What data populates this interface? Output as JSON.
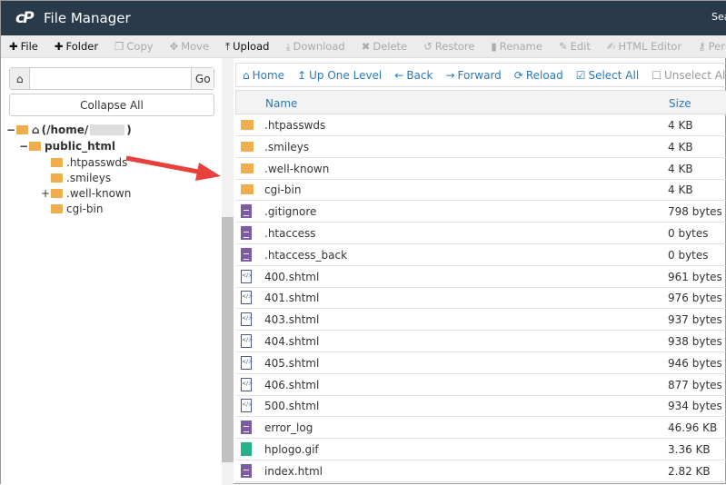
{
  "app": {
    "logo": "cP",
    "title": "File Manager",
    "search_label": "Sea"
  },
  "toolbar": [
    {
      "label": "File",
      "icon": "plus-icon",
      "on": true
    },
    {
      "label": "Folder",
      "icon": "plus-icon",
      "on": true
    },
    {
      "label": "Copy",
      "icon": "copy-icon",
      "on": false
    },
    {
      "label": "Move",
      "icon": "move-icon",
      "on": false
    },
    {
      "label": "Upload",
      "icon": "upload-icon",
      "on": true
    },
    {
      "label": "Download",
      "icon": "download-icon",
      "on": false
    },
    {
      "label": "Delete",
      "icon": "x-icon",
      "on": false
    },
    {
      "label": "Restore",
      "icon": "undo-icon",
      "on": false
    },
    {
      "label": "Rename",
      "icon": "file-icon",
      "on": false
    },
    {
      "label": "Edit",
      "icon": "pencil-icon",
      "on": false
    },
    {
      "label": "HTML Editor",
      "icon": "edit-icon",
      "on": false
    },
    {
      "label": "Perm",
      "icon": "key-icon",
      "on": false
    }
  ],
  "left": {
    "path_value": "",
    "go_label": "Go",
    "collapse_label": "Collapse All",
    "tree": [
      {
        "label": "(/home/",
        "suffix": ")",
        "toggle": "−",
        "bold": true
      },
      {
        "label": "public_html",
        "toggle": "−",
        "bold": true
      },
      {
        "label": ".htpasswds",
        "toggle": ""
      },
      {
        "label": ".smileys",
        "toggle": ""
      },
      {
        "label": ".well-known",
        "toggle": "+"
      },
      {
        "label": "cgi-bin",
        "toggle": ""
      }
    ]
  },
  "nav": [
    {
      "label": "Home",
      "icon": "home-icon"
    },
    {
      "label": "Up One Level",
      "icon": "level-up-icon"
    },
    {
      "label": "Back",
      "icon": "arrow-left-icon"
    },
    {
      "label": "Forward",
      "icon": "arrow-right-icon"
    },
    {
      "label": "Reload",
      "icon": "reload-icon"
    },
    {
      "label": "Select All",
      "icon": "checkbox-checked-icon"
    },
    {
      "label": "Unselect All",
      "icon": "checkbox-empty-icon"
    }
  ],
  "table": {
    "headers": {
      "name": "Name",
      "size": "Size"
    },
    "rows": [
      {
        "name": ".htpasswds",
        "size": "4 KB",
        "type": "folder"
      },
      {
        "name": ".smileys",
        "size": "4 KB",
        "type": "folder"
      },
      {
        "name": ".well-known",
        "size": "4 KB",
        "type": "folder"
      },
      {
        "name": "cgi-bin",
        "size": "4 KB",
        "type": "folder"
      },
      {
        "name": ".gitignore",
        "size": "798 bytes",
        "type": "text"
      },
      {
        "name": ".htaccess",
        "size": "0 bytes",
        "type": "text"
      },
      {
        "name": ".htaccess_back",
        "size": "0 bytes",
        "type": "text"
      },
      {
        "name": "400.shtml",
        "size": "961 bytes",
        "type": "code"
      },
      {
        "name": "401.shtml",
        "size": "976 bytes",
        "type": "code"
      },
      {
        "name": "403.shtml",
        "size": "937 bytes",
        "type": "code"
      },
      {
        "name": "404.shtml",
        "size": "938 bytes",
        "type": "code"
      },
      {
        "name": "405.shtml",
        "size": "946 bytes",
        "type": "code"
      },
      {
        "name": "406.shtml",
        "size": "877 bytes",
        "type": "code"
      },
      {
        "name": "500.shtml",
        "size": "934 bytes",
        "type": "code"
      },
      {
        "name": "error_log",
        "size": "46.96 KB",
        "type": "text"
      },
      {
        "name": "hplogo.gif",
        "size": "3.36 KB",
        "type": "image"
      },
      {
        "name": "index.html",
        "size": "2.82 KB",
        "type": "text"
      }
    ]
  },
  "colors": {
    "titlebar": "#293a4a",
    "link": "#2a7ab8",
    "folder": "#f0ad4e",
    "annotation_arrow": "#e8403a"
  }
}
